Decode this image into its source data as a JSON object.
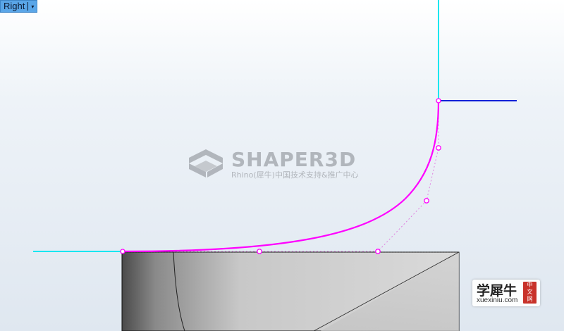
{
  "viewport": {
    "name": "Right",
    "menu_arrow": "▾"
  },
  "watermark": {
    "brand": "SHAPER3D",
    "tagline": "Rhino(犀牛)中国技术支持&推广中心"
  },
  "logo": {
    "chinese": "学犀牛",
    "url": "xuexiniu.com",
    "seal": [
      "中",
      "文",
      "网"
    ]
  },
  "colors": {
    "cyan_curve": "#19e6f0",
    "blue_curve": "#1020d8",
    "magenta_curve": "#ff00ff",
    "control_polygon": "#e080e0",
    "watermark_gray": "#a8acb2"
  }
}
